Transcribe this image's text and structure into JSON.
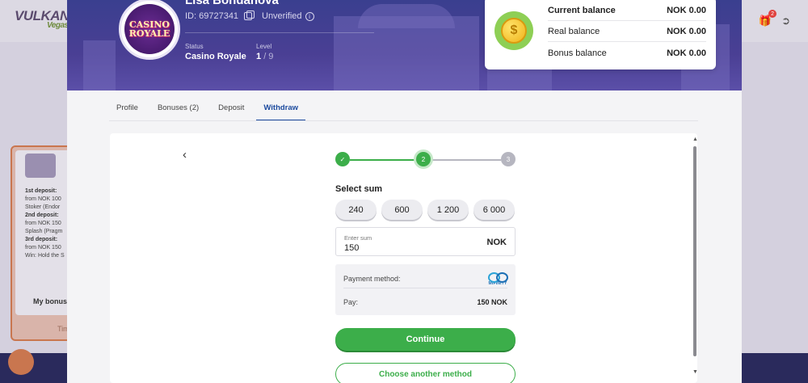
{
  "background": {
    "logo_main": "VULKAN",
    "logo_sub": "Vegas",
    "gift_count": "2",
    "bonus_lines": [
      {
        "label": "1st deposit:",
        "text": "from NOK 100"
      },
      {
        "label": "",
        "text": "Stoker (Endor"
      },
      {
        "label": "2nd deposit:",
        "text": "from NOK 150"
      },
      {
        "label": "",
        "text": "Splash (Pragm"
      },
      {
        "label": "3rd deposit:",
        "text": "from NOK 150"
      },
      {
        "label": "",
        "text": "Win: Hold the S"
      }
    ],
    "bonus_link": "My bonus",
    "bonus_time": "Tim"
  },
  "profile": {
    "name": "Lisa Bondanova",
    "id_text": "ID: 69727341",
    "verification": "Unverified",
    "status_label": "Status",
    "status_value": "Casino Royale",
    "level_label": "Level",
    "level_current": "1",
    "level_total": "/ 9",
    "avatar_text_top": "CASINO",
    "avatar_text_bottom": "ROYALE"
  },
  "balance": {
    "current_label": "Current balance",
    "current_value": "NOK 0.00",
    "real_label": "Real balance",
    "real_value": "NOK 0.00",
    "bonus_label": "Bonus balance",
    "bonus_value": "NOK 0.00"
  },
  "tabs": [
    {
      "label": "Profile"
    },
    {
      "label": "Bonuses (2)"
    },
    {
      "label": "Deposit"
    },
    {
      "label": "Withdraw"
    }
  ],
  "withdraw": {
    "steps": [
      "2",
      "3"
    ],
    "select_sum_title": "Select sum",
    "chips": [
      "240",
      "600",
      "1 200",
      "6 000"
    ],
    "enter_sum_label": "Enter sum",
    "enter_sum_value": "150",
    "currency": "NOK",
    "payment_method_label": "Payment method:",
    "payment_brand": "MIFINITY",
    "pay_label": "Pay:",
    "pay_amount": "150 NOK",
    "continue_label": "Continue",
    "other_method_label": "Choose another method"
  },
  "colors": {
    "accent_green": "#3cae4a",
    "hero_purple": "#4a3f94",
    "tab_active": "#1c4a9e"
  }
}
